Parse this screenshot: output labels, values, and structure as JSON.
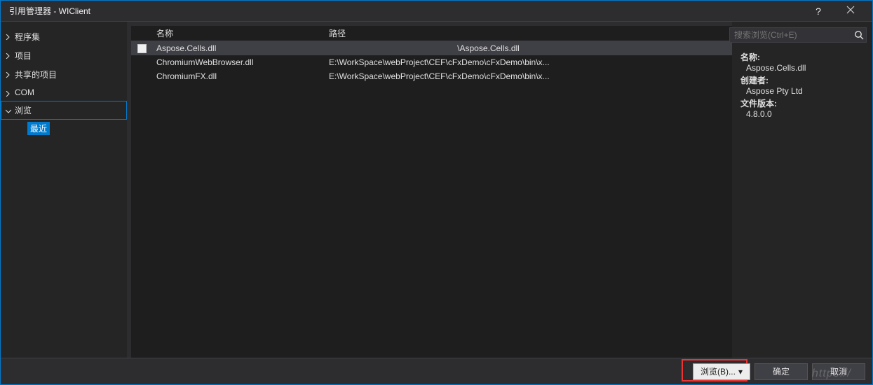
{
  "titlebar": {
    "title": "引用管理器 - WIClient"
  },
  "sidebar": {
    "items": [
      {
        "label": "程序集",
        "expanded": false
      },
      {
        "label": "项目",
        "expanded": false
      },
      {
        "label": "共享的项目",
        "expanded": false
      },
      {
        "label": "COM",
        "expanded": false
      },
      {
        "label": "浏览",
        "expanded": true,
        "selected": true
      }
    ],
    "sub": {
      "recent": "最近"
    }
  },
  "search": {
    "placeholder": "搜索浏览(Ctrl+E)"
  },
  "table": {
    "headers": {
      "name": "名称",
      "path": "路径"
    },
    "rows": [
      {
        "name": "Aspose.Cells.dll",
        "path": "\\Aspose.Cells.dll",
        "selected": true,
        "checked": false
      },
      {
        "name": "ChromiumWebBrowser.dll",
        "path": "E:\\WorkSpace\\webProject\\CEF\\cFxDemo\\cFxDemo\\bin\\x...",
        "selected": false,
        "checked": false
      },
      {
        "name": "ChromiumFX.dll",
        "path": "E:\\WorkSpace\\webProject\\CEF\\cFxDemo\\cFxDemo\\bin\\x...",
        "selected": false,
        "checked": false
      }
    ]
  },
  "details": {
    "name_label": "名称:",
    "name_value": "Aspose.Cells.dll",
    "author_label": "创建者:",
    "author_value": "Aspose Pty Ltd",
    "version_label": "文件版本:",
    "version_value": "4.8.0.0"
  },
  "footer": {
    "browse": "浏览(B)...",
    "ok": "确定",
    "cancel": "取消"
  },
  "watermark": "https://"
}
